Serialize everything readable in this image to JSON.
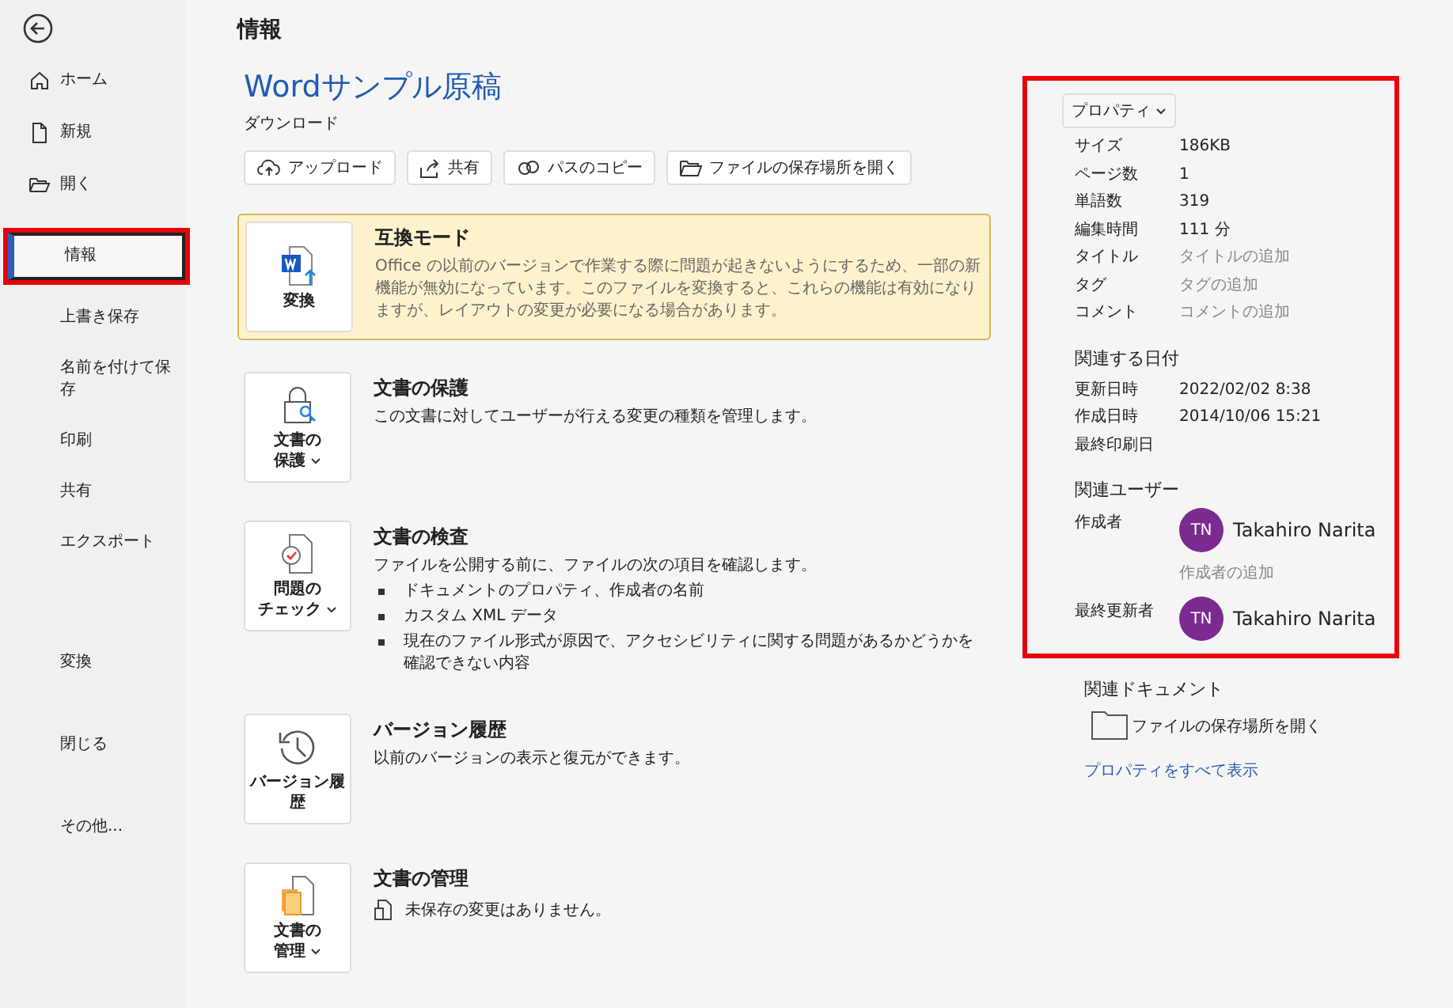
{
  "sidebar": {
    "top_items": [
      {
        "label": "ホーム",
        "selected": false
      },
      {
        "label": "新規",
        "selected": false
      },
      {
        "label": "開く",
        "selected": false
      }
    ],
    "items": [
      {
        "label": "情報",
        "selected": true,
        "highlighted": true
      },
      {
        "label": "上書き保存",
        "selected": false,
        "highlighted": false
      },
      {
        "label": "名前を付けて保存",
        "selected": false,
        "highlighted": false
      },
      {
        "label": "印刷",
        "selected": false,
        "highlighted": false
      },
      {
        "label": "共有",
        "selected": false,
        "highlighted": false
      },
      {
        "label": "エクスポート",
        "selected": false,
        "highlighted": false
      }
    ],
    "bottom_items": [
      {
        "label": "変換",
        "selected": false
      },
      {
        "label": "閉じる",
        "selected": false
      },
      {
        "label": "その他..."
      }
    ]
  },
  "page_title": "情報",
  "document": {
    "title": "Wordサンプル原稿",
    "location": "ダウンロード"
  },
  "toolbar": [
    {
      "label": "アップロード"
    },
    {
      "label": "共有"
    },
    {
      "label": "パスのコピー"
    },
    {
      "label": "ファイルの保存場所を開く"
    }
  ],
  "sections": [
    {
      "kind": "warning",
      "button_lines": [
        "変換"
      ],
      "dropdown": false,
      "title": "互換モード",
      "description": "Office の以前のバージョンで作業する際に問題が起きないようにするため、一部の新機能が無効になっています。このファイルを変換すると、これらの機能は有効になりますが、レイアウトの変更が必要になる場合があります。"
    },
    {
      "kind": "normal",
      "button_lines": [
        "文書の",
        "保護"
      ],
      "dropdown": true,
      "title": "文書の保護",
      "description": "この文書に対してユーザーが行える変更の種類を管理します。"
    },
    {
      "kind": "normal",
      "button_lines": [
        "問題の",
        "チェック"
      ],
      "dropdown": true,
      "title": "文書の検査",
      "description": "ファイルを公開する前に、ファイルの次の項目を確認します。",
      "bullets": [
        "ドキュメントのプロパティ、作成者の名前",
        "カスタム XML データ",
        "現在のファイル形式が原因で、アクセシビリティに関する問題があるかどうかを確認できない内容"
      ]
    },
    {
      "kind": "normal",
      "button_lines": [
        "バージョン履",
        "歴"
      ],
      "dropdown": false,
      "title": "バージョン履歴",
      "description": "以前のバージョンの表示と復元ができます。"
    },
    {
      "kind": "normal",
      "button_lines": [
        "文書の",
        "管理"
      ],
      "dropdown": true,
      "title": "文書の管理",
      "status": "未保存の変更はありません。"
    }
  ],
  "properties": {
    "highlighted": true,
    "button": "プロパティ",
    "rows": [
      {
        "label": "サイズ",
        "value": "186KB"
      },
      {
        "label": "ページ数",
        "value": "1"
      },
      {
        "label": "単語数",
        "value": "319"
      },
      {
        "label": "編集時間",
        "value": "111 分"
      },
      {
        "label": "タイトル",
        "placeholder": "タイトルの追加"
      },
      {
        "label": "タグ",
        "placeholder": "タグの追加"
      },
      {
        "label": "コメント",
        "placeholder": "コメントの追加"
      }
    ],
    "dates_heading": "関連する日付",
    "dates": [
      {
        "label": "更新日時",
        "value": "2022/02/02 8:38"
      },
      {
        "label": "作成日時",
        "value": "2014/10/06 15:21"
      },
      {
        "label": "最終印刷日"
      }
    ],
    "users_heading": "関連ユーザー",
    "users": [
      {
        "label": "作成者",
        "initials": "TN",
        "name": "Takahiro Narita",
        "color": "#7b2a90",
        "add": "作成者の追加"
      },
      {
        "label": "最終更新者",
        "initials": "TN",
        "name": "Takahiro Narita",
        "color": "#7b2a90"
      }
    ]
  },
  "related": {
    "heading": "関連ドキュメント",
    "open_location": "ファイルの保存場所を開く",
    "show_all": "プロパティをすべて表示"
  }
}
